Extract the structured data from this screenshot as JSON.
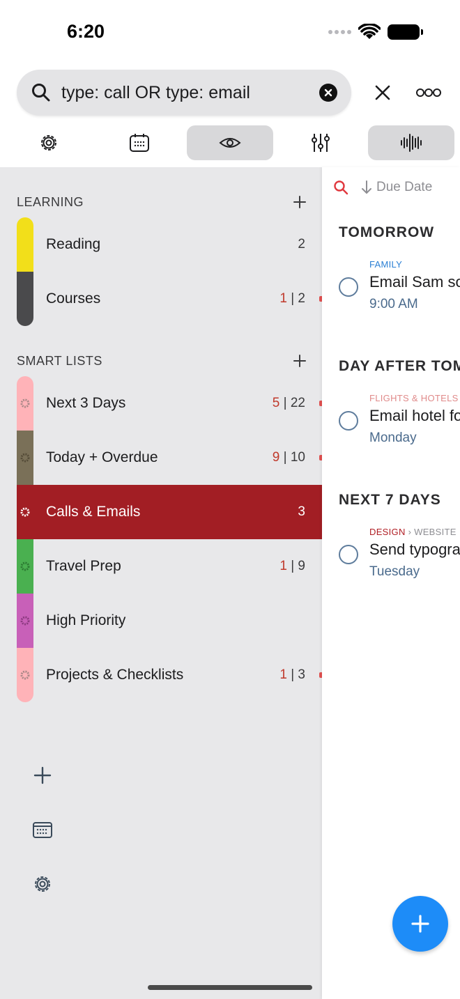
{
  "status": {
    "time": "6:20"
  },
  "search": {
    "query": "type: call OR type: email"
  },
  "sidebar": {
    "sections": [
      {
        "title": "LEARNING",
        "color": "#3a3a3c"
      },
      {
        "title": "SMART LISTS",
        "color": "#3a3a3c"
      }
    ],
    "learning": [
      {
        "label": "Reading",
        "count": "2",
        "overdue": "",
        "color": "#f2df1a"
      },
      {
        "label": "Courses",
        "count": "2",
        "overdue": "1",
        "color": "#4a4a4c"
      }
    ],
    "smart": [
      {
        "label": "Next 3 Days",
        "count": "22",
        "overdue": "5",
        "color": "#ffb3b8"
      },
      {
        "label": "Today + Overdue",
        "count": "10",
        "overdue": "9",
        "color": "#7a7058"
      },
      {
        "label": "Calls & Emails",
        "count": "3",
        "overdue": "",
        "color": "#a21e24"
      },
      {
        "label": "Travel Prep",
        "count": "9",
        "overdue": "1",
        "color": "#4ab050"
      },
      {
        "label": "High Priority",
        "count": "",
        "overdue": "",
        "color": "#c860b8"
      },
      {
        "label": "Projects & Checklists",
        "count": "3",
        "overdue": "1",
        "color": "#ffb3b8"
      }
    ],
    "separator": "|"
  },
  "panel": {
    "sort_label": "Due Date",
    "groups": [
      {
        "title": "TOMORROW"
      },
      {
        "title": "DAY AFTER TOMORROW"
      },
      {
        "title": "NEXT 7 DAYS"
      }
    ],
    "tasks": [
      {
        "tag": "FAMILY",
        "tag_color": "#2a7fd4",
        "tag2": "",
        "title": "Email Sam so",
        "date": "9:00 AM"
      },
      {
        "tag": "FLIGHTS & HOTELS",
        "tag_color": "#e08a8a",
        "tag2": "",
        "title": "Email hotel fo",
        "date": "Monday"
      },
      {
        "tag": "DESIGN",
        "tag_color": "#b01e24",
        "tag2": "› WEBSITE",
        "title": "Send typogra",
        "date": "Tuesday"
      }
    ]
  },
  "colors": {
    "accent": "#a21e24",
    "fab": "#1d8cf8",
    "sidebar_bg": "#e8e8ea"
  }
}
